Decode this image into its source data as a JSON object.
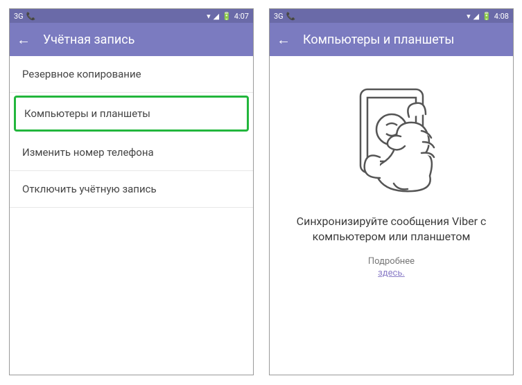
{
  "colors": {
    "statusbar": "#6a6aa8",
    "appbar": "#7b7bc0",
    "highlight_border": "#22b63c",
    "link": "#8a7cc7"
  },
  "left": {
    "statusbar": {
      "network_icon": "3G",
      "call_icon": "📞",
      "wifi_icon": "▾",
      "signal_icon": "◢",
      "battery_icon": "🔋",
      "time": "4:07"
    },
    "appbar": {
      "back_icon": "←",
      "title": "Учётная запись"
    },
    "menu": [
      "Резервное копирование",
      "Компьютеры и планшеты",
      "Изменить номер телефона",
      "Отключить учётную запись"
    ],
    "highlight_index": 1
  },
  "right": {
    "statusbar": {
      "network_icon": "3G",
      "call_icon": "📞",
      "wifi_icon": "▾",
      "signal_icon": "◢",
      "battery_icon": "🔋",
      "time": "4:08"
    },
    "appbar": {
      "back_icon": "←",
      "title": "Компьютеры и планшеты"
    },
    "message": "Синхронизируйте сообщения Viber с компьютером или планшетом",
    "more_label": "Подробнее",
    "more_link": "здесь."
  }
}
